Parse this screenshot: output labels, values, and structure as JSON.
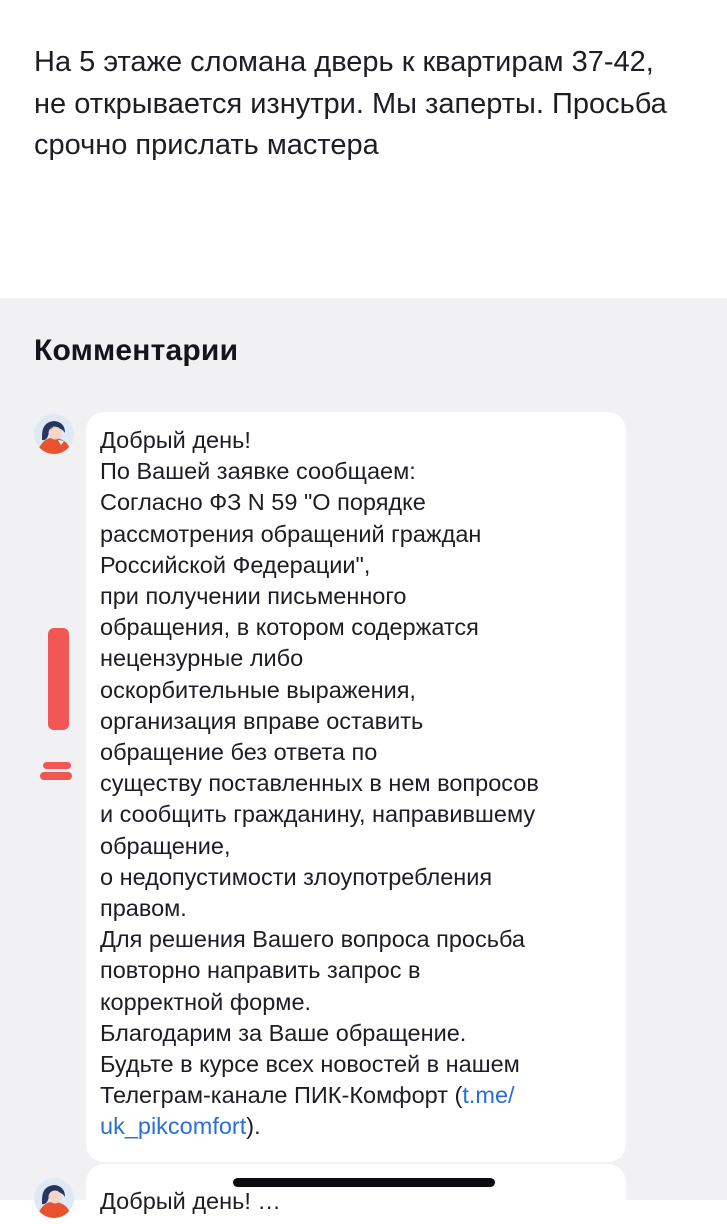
{
  "request": {
    "text": "На 5 этаже сломана дверь к квартирам 37-42, не открывается изнутри. Мы заперты. Просьба срочно прислать мастера"
  },
  "comments": {
    "title": "Комментарии",
    "items": [
      {
        "avatar_icon": "support-agent-avatar-icon",
        "body": "Добрый день!\nПо Вашей заявке сообщаем:\nСогласно ФЗ N 59 \"О порядке\nрассмотрения обращений граждан\nРоссийской Федерации\",\nпри получении письменного\nобращения, в котором содержатся\nнецензурные либо\nоскорбительные выражения,\nорганизация вправе оставить\nобращение без ответа по\nсуществу поставленных в нем вопросов\nи сообщить гражданину, направившему\nобращение,\nо недопустимости злоупотребления\nправом.\nДля решения Вашего вопроса просьба\nповторно направить запрос в\nкорректной форме.\nБлагодарим за Ваше обращение.\nБудьте в курсе всех новостей в нашем\nТелеграм-канале ПИК-Комфорт (",
        "link_text": "t.me/\nuk_pikcomfort",
        "body_end": ")."
      },
      {
        "avatar_icon": "support-agent-avatar-icon",
        "body": "Добрый день! …"
      }
    ]
  },
  "colors": {
    "accent_link": "#2a6fd6",
    "comments_background": "#f1f1f3",
    "annotation_red": "#f04a48"
  }
}
